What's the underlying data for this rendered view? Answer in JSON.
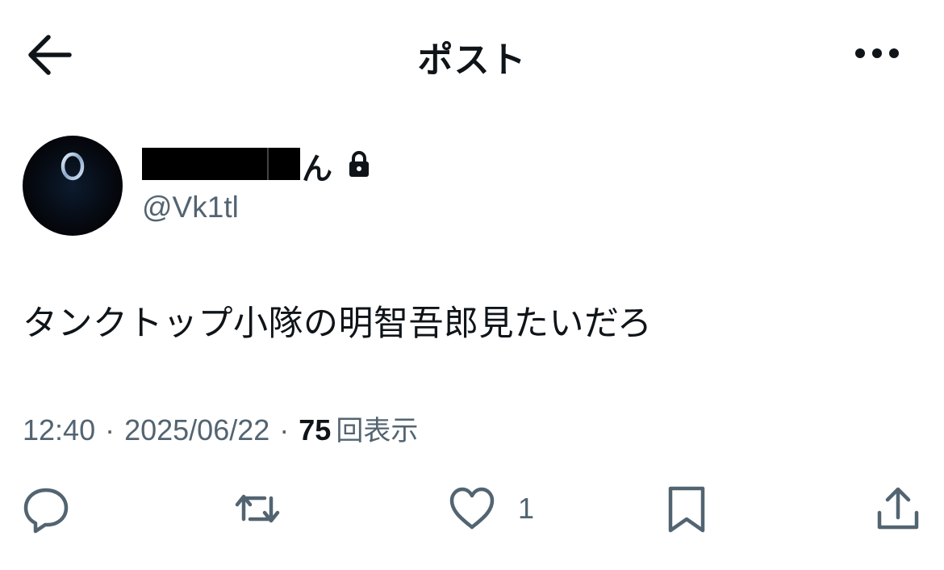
{
  "header": {
    "title": "ポスト",
    "back_icon": "arrow-left-icon",
    "more_icon": "more-horizontal-icon"
  },
  "author": {
    "display_name_visible_suffix": "ん",
    "display_name_redacted": true,
    "protected_icon": "lock-icon",
    "handle": "@Vk1tl",
    "avatar_icon": "ankh-icon"
  },
  "post": {
    "text": "タンクトップ小隊の明智吾郎見たいだろ"
  },
  "meta": {
    "time": "12:40",
    "separator": "·",
    "date": "2025/06/22",
    "views_count": "75",
    "views_label": "回表示"
  },
  "actions": {
    "reply_icon": "reply-icon",
    "repost_icon": "repost-icon",
    "like_icon": "heart-icon",
    "like_count": "1",
    "bookmark_icon": "bookmark-icon",
    "share_icon": "share-icon"
  },
  "colors": {
    "text_primary": "#0f1419",
    "text_secondary": "#536471",
    "background": "#ffffff"
  }
}
